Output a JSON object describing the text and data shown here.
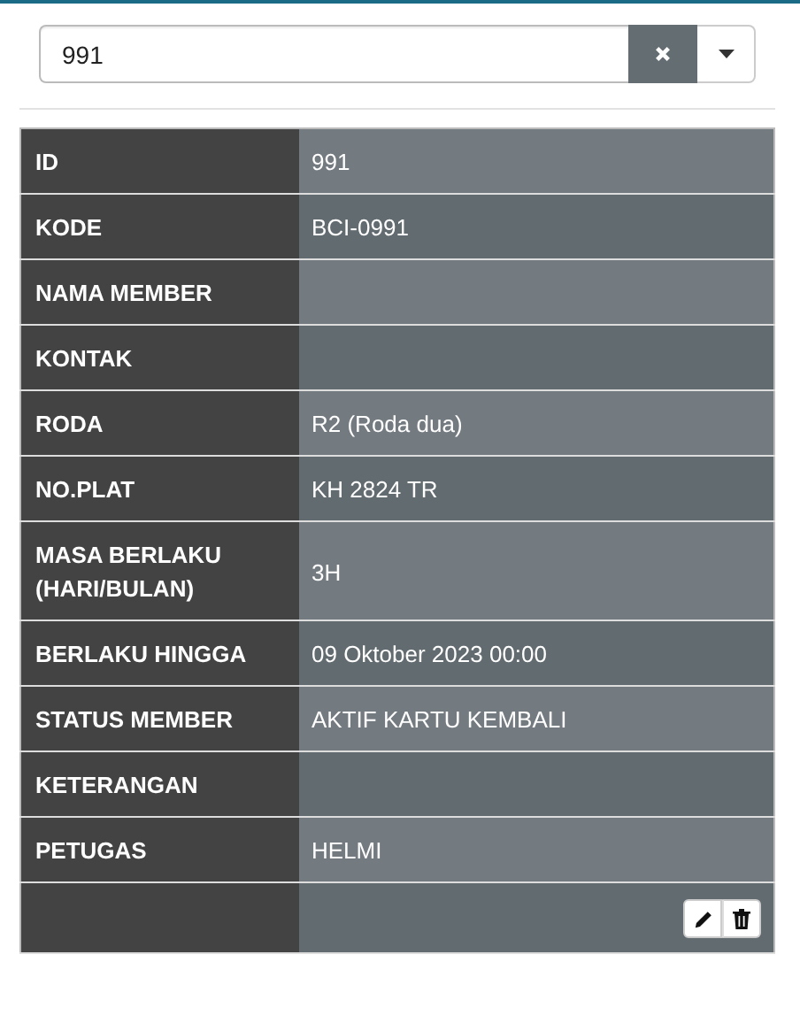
{
  "search": {
    "value": "991"
  },
  "rows": [
    {
      "label": "ID",
      "value": "991"
    },
    {
      "label": "KODE",
      "value": "BCI-0991"
    },
    {
      "label": "NAMA MEMBER"
    },
    {
      "label": "KONTAK"
    },
    {
      "label": "RODA",
      "value": "R2 (Roda dua)"
    },
    {
      "label": "NO.PLAT",
      "value": "KH 2824 TR"
    },
    {
      "label": "MASA BERLAKU (HARI/BULAN)",
      "value": "3H"
    },
    {
      "label": "BERLAKU HINGGA",
      "value": "09 Oktober 2023 00:00"
    },
    {
      "label": "STATUS MEMBER",
      "value": "AKTIF KARTU KEMBALI"
    },
    {
      "label": "KETERANGAN"
    },
    {
      "label": "PETUGAS",
      "value": "HELMI"
    }
  ],
  "actions": [
    {
      "kind": "edit"
    },
    {
      "kind": "delete"
    }
  ]
}
